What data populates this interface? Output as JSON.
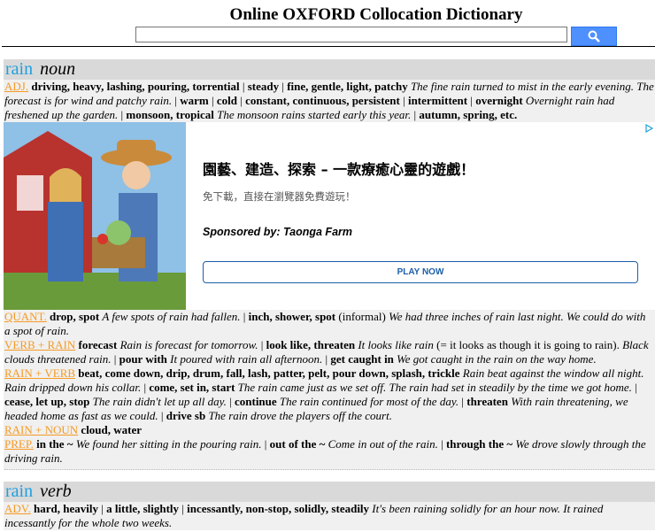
{
  "header": {
    "title": "Online OXFORD Collocation Dictionary",
    "search_value": ""
  },
  "entry1": {
    "headword": "rain",
    "pos": "noun",
    "adj_label": "ADJ.",
    "adj": [
      {
        "c": "driving, heavy, lashing, pouring, torrential"
      },
      {
        "c": "steady"
      },
      {
        "c": "fine, gentle, light, patchy",
        "e": "The fine rain turned to mist in the early evening. The forecast is for wind and patchy rain."
      },
      {
        "c": "warm"
      },
      {
        "c": "cold"
      },
      {
        "c": "constant, continuous, persistent"
      },
      {
        "c": "intermittent"
      },
      {
        "c": "overnight",
        "e": "Overnight rain had freshened up the garden."
      },
      {
        "c": "monsoon, tropical",
        "e": "The monsoon rains started early this year."
      },
      {
        "c": "autumn, spring, etc."
      }
    ],
    "quant_label": "QUANT.",
    "quant_c1": "drop, spot",
    "quant_e1": "A few spots of rain had fallen.",
    "quant_c2": "inch, shower, spot",
    "quant_n2": "(informal)",
    "quant_e2": "We had three inches of rain last night. We could do with a spot of rain.",
    "verb_rain_label": "VERB + RAIN",
    "vr_c1": "forecast",
    "vr_e1": "Rain is forecast for tomorrow.",
    "vr_c2": "look like, threaten",
    "vr_e2": "It looks like rain",
    "vr_n2": "(= it looks as though it is going to rain).",
    "vr_e2b": "Black clouds threatened rain.",
    "vr_c3": "pour with",
    "vr_e3": "It poured with rain all afternoon.",
    "vr_c4": "get caught in",
    "vr_e4": "We got caught in the rain on the way home.",
    "rain_verb_label": "RAIN + VERB",
    "rv_c1": "beat, come down, drip, drum, fall, lash, patter, pelt, pour down, splash, trickle",
    "rv_e1": "Rain beat against the window all night. Rain dripped down his collar.",
    "rv_c2": "come, set in, start",
    "rv_e2": "The rain came just as we set off. The rain had set in steadily by the time we got home.",
    "rv_c3": "cease, let up, stop",
    "rv_e3": "The rain didn't let up all day.",
    "rv_c4": "continue",
    "rv_e4": "The rain continued for most of the day.",
    "rv_c5": "threaten",
    "rv_e5": "With rain threatening, we headed home as fast as we could.",
    "rv_c6": "drive sb",
    "rv_e6": "The rain drove the players off the court.",
    "rain_noun_label": "RAIN + NOUN",
    "rn_c": "cloud, water",
    "prep_label": "PREP.",
    "p_c1": "in the ~",
    "p_e1": "We found her sitting in the pouring rain.",
    "p_c2": "out of the ~",
    "p_e2": "Come in out of the rain.",
    "p_c3": "through the ~",
    "p_e3": "We drove slowly through the driving rain."
  },
  "ad": {
    "headline": "園藝、建造、探索 – 一款療癒心靈的遊戲！",
    "sub": "免下載，直接在瀏覽器免費遊玩！",
    "sponsor": "Sponsored by: Taonga Farm",
    "button": "PLAY NOW"
  },
  "entry2": {
    "headword": "rain",
    "pos": "verb",
    "adv_label": "ADV.",
    "a_c1": "hard, heavily",
    "a_c2": "a little, slightly",
    "a_c3": "incessantly, non-stop, solidly, steadily",
    "a_e3": "It's been raining solidly for an hour now. It rained incessantly for the whole two weeks."
  },
  "colors": {
    "headword": "#1e9fe0",
    "label": "#f59a23",
    "search_button": "#4d90fe"
  }
}
